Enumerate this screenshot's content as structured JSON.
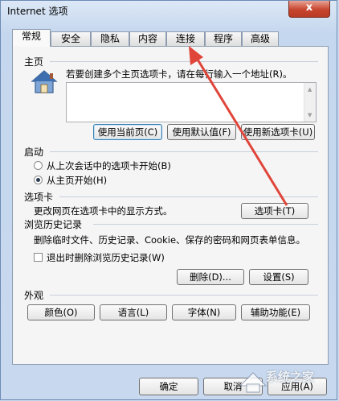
{
  "window": {
    "title": "Internet 选项",
    "close": "x"
  },
  "tabs": [
    "常规",
    "安全",
    "隐私",
    "内容",
    "连接",
    "程序",
    "高级"
  ],
  "home": {
    "section": "主页",
    "description": "若要创建多个主页选项卡，请在每行输入一个地址(R)。",
    "url_value": "",
    "buttons": {
      "use_current": "使用当前页(C)",
      "use_default": "使用默认值(F)",
      "use_new_tab": "使用新选项卡(U)"
    }
  },
  "startup": {
    "section": "启动",
    "option1": "从上次会话中的选项卡开始(B)",
    "option2": "从主页开始(H)",
    "selected": 2
  },
  "tabs_section": {
    "section": "选项卡",
    "description": "更改网页在选项卡中的显示方式。",
    "button": "选项卡(T)"
  },
  "history": {
    "section": "浏览历史记录",
    "description": "删除临时文件、历史记录、Cookie、保存的密码和网页表单信息。",
    "checkbox": "退出时删除浏览历史记录(W)",
    "checked": false,
    "delete": "删除(D)...",
    "settings": "设置(S)"
  },
  "appearance": {
    "section": "外观",
    "colors": "颜色(O)",
    "languages": "语言(L)",
    "fonts": "字体(N)",
    "accessibility": "辅助功能(E)"
  },
  "footer": {
    "ok": "确定",
    "cancel": "取消",
    "apply": "应用(A)"
  },
  "watermark": "系统之家",
  "colors": {
    "arrow": "#e0453a",
    "accent": "#3c7fb1"
  }
}
